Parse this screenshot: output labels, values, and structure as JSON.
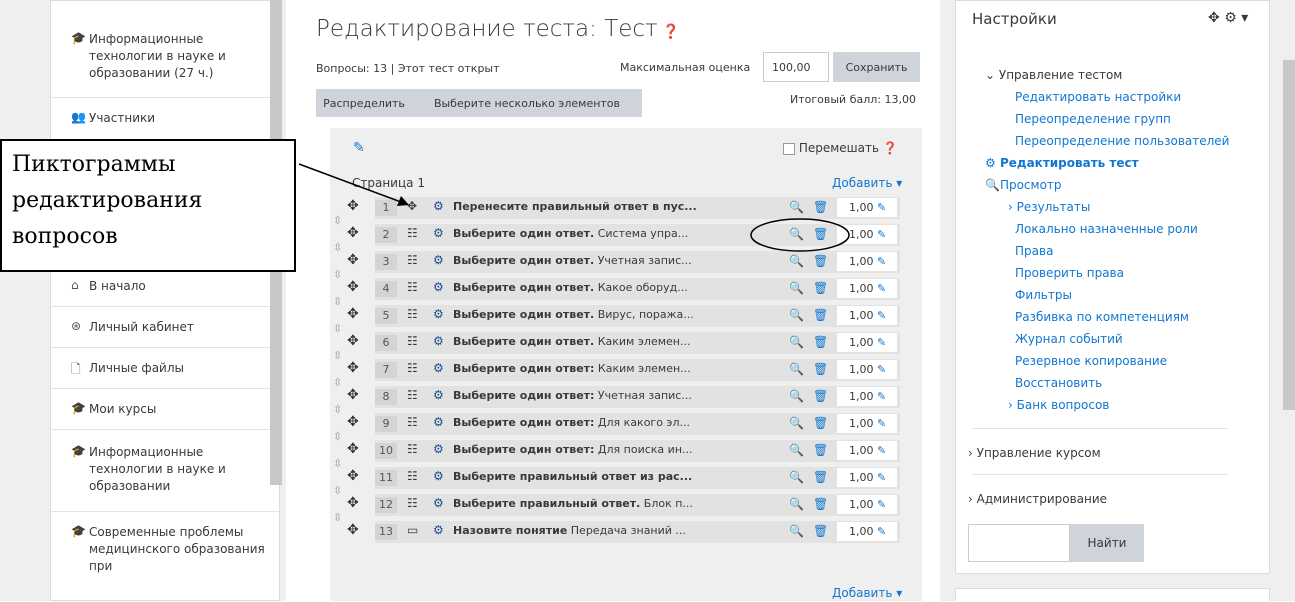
{
  "left_nav": {
    "items": [
      {
        "icon": "graduation-cap-icon",
        "label": "Информационные технологии в науке и образовании (27 ч.)"
      },
      {
        "icon": "users-icon",
        "label": "Участники"
      },
      {
        "icon": "home-icon",
        "label": "В начало"
      },
      {
        "icon": "dashboard-icon",
        "label": "Личный кабинет"
      },
      {
        "icon": "file-icon",
        "label": "Личные файлы"
      },
      {
        "icon": "graduation-cap-icon",
        "label": "Мои курсы"
      },
      {
        "icon": "graduation-cap-icon",
        "label": "Информационные технологии в науке и образовании"
      },
      {
        "icon": "graduation-cap-icon",
        "label": "Современные проблемы медицинского образования при"
      }
    ]
  },
  "header": {
    "title": "Редактирование теста: Тест",
    "questions_info": "Вопросы: 13 | Этот тест открыт",
    "max_grade_label": "Максимальная оценка",
    "max_grade_value": "100,00",
    "save_label": "Сохранить",
    "total_label": "Итоговый балл: 13,00"
  },
  "toolbar": {
    "repaginate_label": "Распределить",
    "select_multiple_label": "Выберите несколько элементов"
  },
  "section": {
    "shuffle_label": "Перемешать",
    "page_label": "Страница 1",
    "add_label": "Добавить"
  },
  "questions": [
    {
      "num": "1",
      "type": "drag-icon",
      "bold": "Перенесите правильный ответ в пус...",
      "rest": "",
      "mark": "1,00"
    },
    {
      "num": "2",
      "type": "multichoice-icon",
      "bold": "Выберите один ответ.",
      "rest": " Система упра...",
      "mark": "1,00"
    },
    {
      "num": "3",
      "type": "multichoice-icon",
      "bold": "Выберите один ответ.",
      "rest": " Учетная запис...",
      "mark": "1,00"
    },
    {
      "num": "4",
      "type": "multichoice-icon",
      "bold": "Выберите один ответ.",
      "rest": " Какое оборуд...",
      "mark": "1,00"
    },
    {
      "num": "5",
      "type": "multichoice-icon",
      "bold": "Выберите один ответ.",
      "rest": " Вирус, поража...",
      "mark": "1,00"
    },
    {
      "num": "6",
      "type": "multichoice-icon",
      "bold": "Выберите один ответ.",
      "rest": " Каким элемен...",
      "mark": "1,00"
    },
    {
      "num": "7",
      "type": "multichoice-icon",
      "bold": "Выберите один ответ:",
      "rest": " Каким элемен...",
      "mark": "1,00"
    },
    {
      "num": "8",
      "type": "multichoice-icon",
      "bold": "Выберите один ответ:",
      "rest": " Учетная запис...",
      "mark": "1,00"
    },
    {
      "num": "9",
      "type": "multichoice-icon",
      "bold": "Выберите один ответ:",
      "rest": " Для какого эл...",
      "mark": "1,00"
    },
    {
      "num": "10",
      "type": "multichoice-icon",
      "bold": "Выберите один ответ:",
      "rest": " Для поиска ин...",
      "mark": "1,00"
    },
    {
      "num": "11",
      "type": "multichoice-icon",
      "bold": "Выберите правильный ответ из рас...",
      "rest": "",
      "mark": "1,00"
    },
    {
      "num": "12",
      "type": "multichoice-icon",
      "bold": "Выберите правильный ответ.",
      "rest": " Блок п...",
      "mark": "1,00"
    },
    {
      "num": "13",
      "type": "shortanswer-icon",
      "bold": "Назовите понятие",
      "rest": " Передача знаний ...",
      "mark": "1,00"
    }
  ],
  "callout": {
    "text": "Пиктограммы редактирования вопросов"
  },
  "settings": {
    "title": "Настройки",
    "quiz_admin_label": "Управление тестом",
    "links": [
      "Редактировать настройки",
      "Переопределение групп",
      "Переопределение пользователей"
    ],
    "edit_quiz_label": "Редактировать тест",
    "preview_label": "Просмотр",
    "results_label": "Результаты",
    "links2": [
      "Локально назначенные роли",
      "Права",
      "Проверить права",
      "Фильтры",
      "Разбивка по компетенциям",
      "Журнал событий",
      "Резервное копирование",
      "Восстановить"
    ],
    "question_bank_label": "Банк вопросов",
    "course_admin_label": "Управление курсом",
    "site_admin_label": "Администрирование",
    "search_button": "Найти"
  },
  "colors": {
    "link": "#1177d1",
    "panel": "#efefef",
    "button": "#ced4da"
  }
}
